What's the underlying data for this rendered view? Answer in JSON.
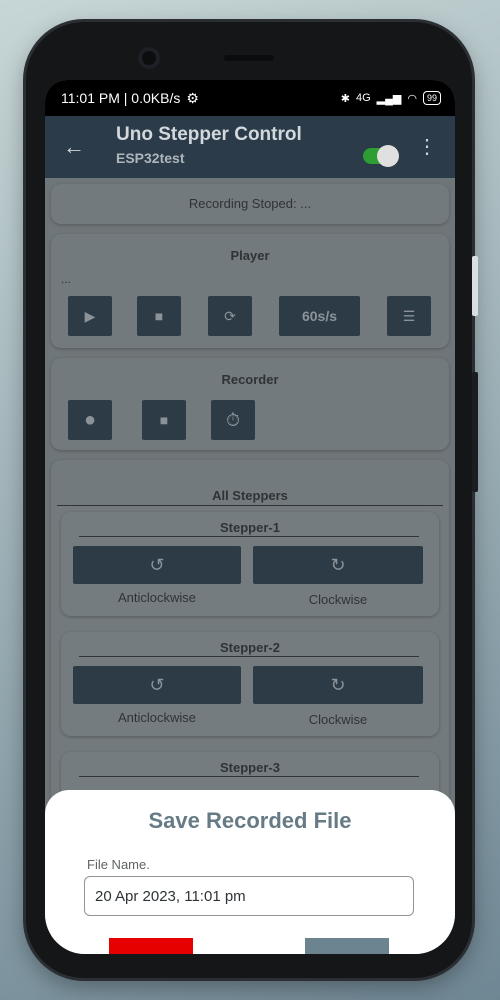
{
  "status_bar": {
    "time": "11:01 PM | 0.0KB/s",
    "battery": "99",
    "signal": "4G"
  },
  "app_bar": {
    "title": "Uno Stepper Control",
    "subtitle": "ESP32test"
  },
  "recording_status": "Recording Stoped: ...",
  "player": {
    "title": "Player",
    "info": "...",
    "rate_label": "60s/s"
  },
  "recorder": {
    "title": "Recorder"
  },
  "all_steppers": {
    "title": "All Steppers",
    "steppers": [
      {
        "name": "Stepper-1",
        "anticlockwise": "Anticlockwise",
        "clockwise": "Clockwise"
      },
      {
        "name": "Stepper-2",
        "anticlockwise": "Anticlockwise",
        "clockwise": "Clockwise"
      },
      {
        "name": "Stepper-3"
      }
    ]
  },
  "dialog": {
    "title": "Save Recorded File",
    "field_label": "File Name.",
    "file_name": "20 Apr 2023, 11:01 pm"
  },
  "colors": {
    "app_bar": "#2b3b49",
    "button": "#2d3b46",
    "dialog_title": "#667b86",
    "accent_red": "#e60000",
    "toggle_on": "#2e9d33"
  }
}
